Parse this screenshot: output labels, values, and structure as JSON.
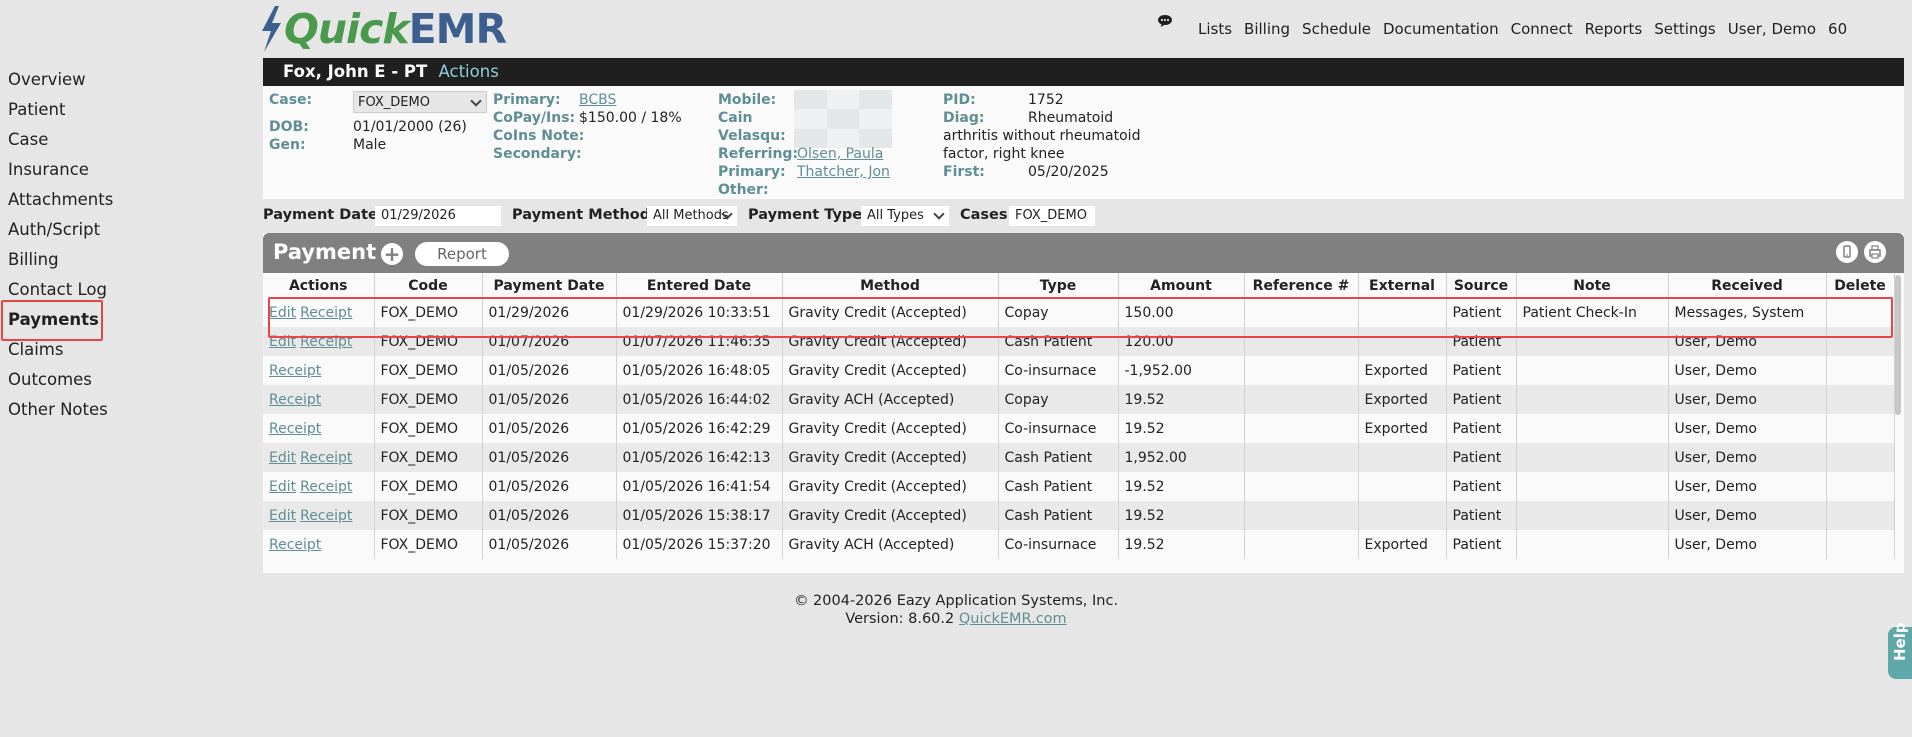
{
  "brand": {
    "logo_part1": "Quick",
    "logo_part2": "EMR"
  },
  "nav": {
    "items": [
      "Lists",
      "Billing",
      "Schedule",
      "Documentation",
      "Connect",
      "Reports",
      "Settings",
      "User, Demo",
      "60"
    ]
  },
  "sidebar": {
    "items": [
      "Overview",
      "Patient",
      "Case",
      "Insurance",
      "Attachments",
      "Auth/Script",
      "Billing",
      "Contact Log",
      "Payments",
      "Claims",
      "Outcomes",
      "Other Notes"
    ],
    "active": "Payments"
  },
  "patient": {
    "name": "Fox, John E - PT",
    "actions_label": "Actions",
    "case_label": "Case:",
    "case_value": "FOX_DEMO",
    "dob_label": "DOB:",
    "dob_value": "01/01/2000 (26)",
    "gen_label": "Gen:",
    "gen_value": "Male",
    "primary_label": "Primary:",
    "primary_value": "BCBS",
    "copay_label": "CoPay/Ins:",
    "copay_value": "$150.00 / 18%",
    "coins_label": "CoIns Note:",
    "secondary_label": "Secondary:",
    "mobile_label": "Mobile:",
    "cain_label": "Cain",
    "velasqu_label": "Velasqu:",
    "referring_label": "Referring:",
    "referring_value": "Olsen, Paula",
    "primary2_label": "Primary:",
    "primary2_value": "Thatcher, Jon",
    "other_label": "Other:",
    "pid_label": "PID:",
    "pid_value": "1752",
    "diag_label": "Diag:",
    "diag_value": "Rheumatoid",
    "diag_line2": "arthritis without rheumatoid",
    "diag_line3": "factor, right knee",
    "first_label": "First:",
    "first_value": "05/20/2025"
  },
  "filters": {
    "payment_date_label": "Payment Date",
    "payment_date_value": "01/29/2026",
    "method_label": "Payment Method",
    "method_value": "All Methods",
    "type_label": "Payment Type",
    "type_value": "All Types",
    "cases_label": "Cases",
    "cases_value": "FOX_DEMO"
  },
  "payments": {
    "title": "Payment",
    "add_symbol": "+",
    "report_label": "Report",
    "columns": [
      "Actions",
      "Code",
      "Payment Date",
      "Entered Date",
      "Method",
      "Type",
      "Amount",
      "Reference #",
      "External",
      "Source",
      "Note",
      "Received",
      "Delete"
    ],
    "rows": [
      {
        "edit": "Edit",
        "receipt": "Receipt",
        "code": "FOX_DEMO",
        "pay_date": "01/29/2026",
        "entered": "01/29/2026 10:33:51",
        "method": "Gravity Credit (Accepted)",
        "type": "Copay",
        "amount": "150.00",
        "ref": "",
        "external": "",
        "source": "Patient",
        "note": "Patient Check-In",
        "received": "Messages, System"
      },
      {
        "edit": "Edit",
        "receipt": "Receipt",
        "code": "FOX_DEMO",
        "pay_date": "01/07/2026",
        "entered": "01/07/2026 11:46:35",
        "method": "Gravity Credit (Accepted)",
        "type": "Cash Patient",
        "amount": "120.00",
        "ref": "",
        "external": "",
        "source": "Patient",
        "note": "",
        "received": "User, Demo"
      },
      {
        "edit": "",
        "receipt": "Receipt",
        "code": "FOX_DEMO",
        "pay_date": "01/05/2026",
        "entered": "01/05/2026 16:48:05",
        "method": "Gravity Credit (Accepted)",
        "type": "Co-insurnace",
        "amount": "-1,952.00",
        "ref": "",
        "external": "Exported",
        "source": "Patient",
        "note": "",
        "received": "User, Demo"
      },
      {
        "edit": "",
        "receipt": "Receipt",
        "code": "FOX_DEMO",
        "pay_date": "01/05/2026",
        "entered": "01/05/2026 16:44:02",
        "method": "Gravity ACH (Accepted)",
        "type": "Copay",
        "amount": "19.52",
        "ref": "",
        "external": "Exported",
        "source": "Patient",
        "note": "",
        "received": "User, Demo"
      },
      {
        "edit": "",
        "receipt": "Receipt",
        "code": "FOX_DEMO",
        "pay_date": "01/05/2026",
        "entered": "01/05/2026 16:42:29",
        "method": "Gravity Credit (Accepted)",
        "type": "Co-insurnace",
        "amount": "19.52",
        "ref": "",
        "external": "Exported",
        "source": "Patient",
        "note": "",
        "received": "User, Demo"
      },
      {
        "edit": "Edit",
        "receipt": "Receipt",
        "code": "FOX_DEMO",
        "pay_date": "01/05/2026",
        "entered": "01/05/2026 16:42:13",
        "method": "Gravity Credit (Accepted)",
        "type": "Cash Patient",
        "amount": "1,952.00",
        "ref": "",
        "external": "",
        "source": "Patient",
        "note": "",
        "received": "User, Demo"
      },
      {
        "edit": "Edit",
        "receipt": "Receipt",
        "code": "FOX_DEMO",
        "pay_date": "01/05/2026",
        "entered": "01/05/2026 16:41:54",
        "method": "Gravity Credit (Accepted)",
        "type": "Cash Patient",
        "amount": "19.52",
        "ref": "",
        "external": "",
        "source": "Patient",
        "note": "",
        "received": "User, Demo"
      },
      {
        "edit": "Edit",
        "receipt": "Receipt",
        "code": "FOX_DEMO",
        "pay_date": "01/05/2026",
        "entered": "01/05/2026 15:38:17",
        "method": "Gravity Credit (Accepted)",
        "type": "Cash Patient",
        "amount": "19.52",
        "ref": "",
        "external": "",
        "source": "Patient",
        "note": "",
        "received": "User, Demo"
      },
      {
        "edit": "",
        "receipt": "Receipt",
        "code": "FOX_DEMO",
        "pay_date": "01/05/2026",
        "entered": "01/05/2026 15:37:20",
        "method": "Gravity ACH (Accepted)",
        "type": "Co-insurnace",
        "amount": "19.52",
        "ref": "",
        "external": "Exported",
        "source": "Patient",
        "note": "",
        "received": "User, Demo"
      }
    ]
  },
  "footer": {
    "copyright": "© 2004-2026 Eazy Application Systems, Inc.",
    "version": "Version: 8.60.2",
    "link": "QuickEMR.com"
  },
  "help": {
    "label": "Help"
  },
  "icons": {
    "chat": "chat-bubble-icon",
    "bolt": "lightning-bolt-icon",
    "add": "plus-circle-icon",
    "mobile": "mobile-icon",
    "print": "print-icon"
  },
  "colors": {
    "accent": "#5f8e95",
    "header_bg": "#1f1f1f",
    "panel_head": "#808080",
    "highlight": "#e84545",
    "logo_green": "#4a9a4e",
    "logo_blue": "#3d5f8f"
  }
}
